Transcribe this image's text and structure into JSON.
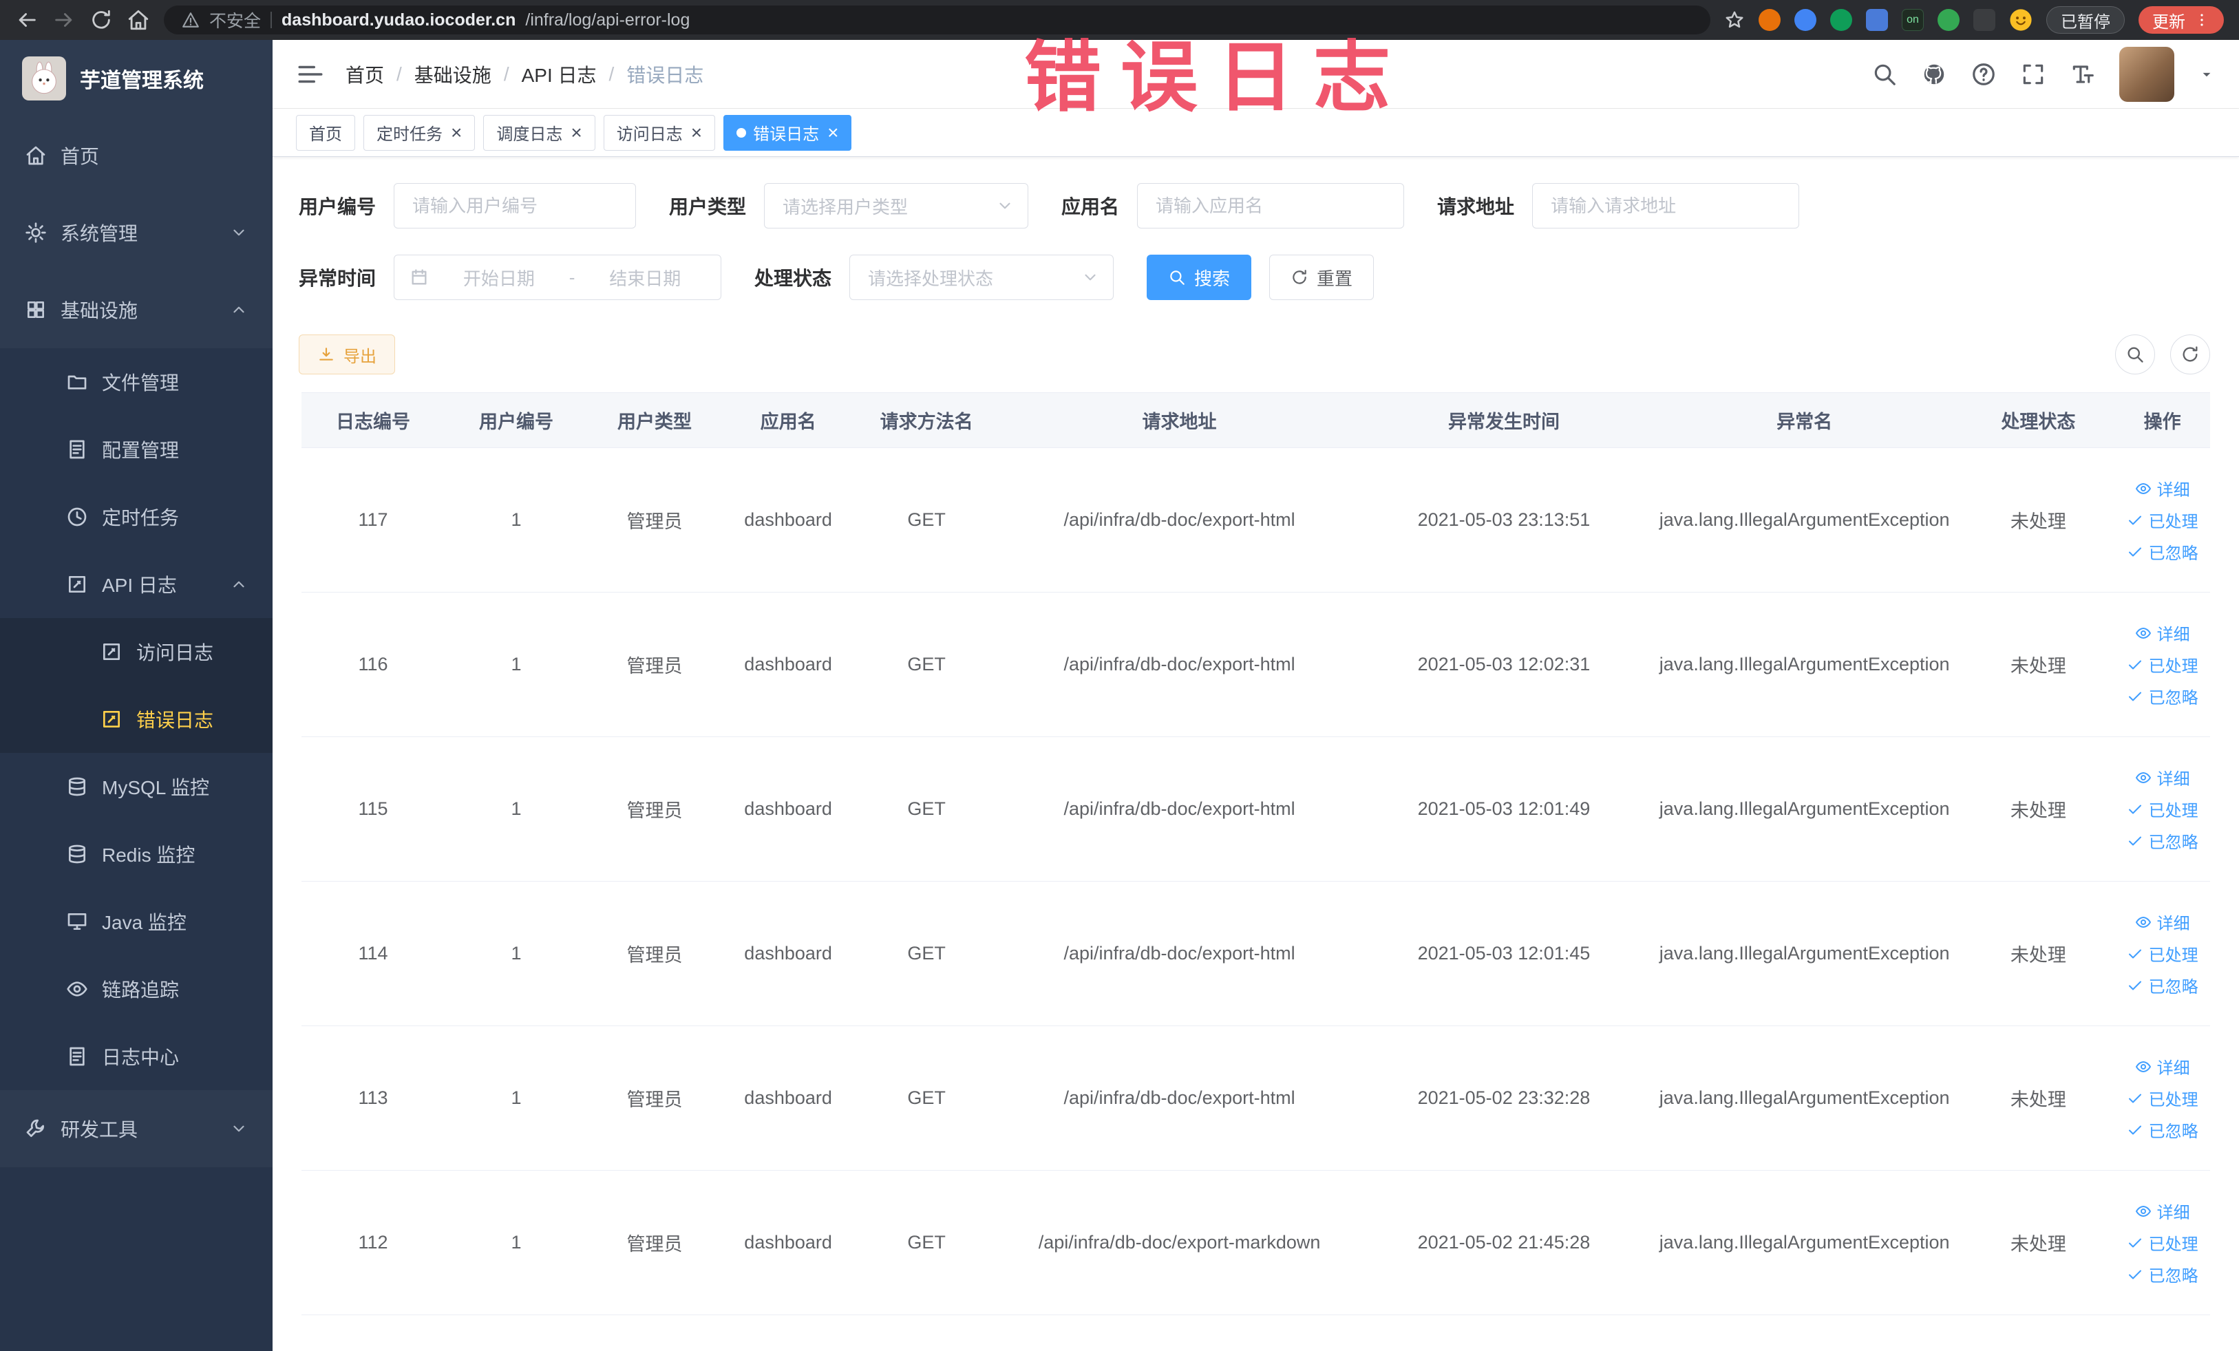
{
  "accent_colors": {
    "primary": "#409eff",
    "active_menu": "#ffd04b",
    "warning": "#e6a23c",
    "annotation": "#ef4b63"
  },
  "annotation": {
    "text": "错误日志"
  },
  "browser": {
    "security_label": "不安全",
    "url_host": "dashboard.yudao.iocoder.cn",
    "url_path": "/infra/log/api-error-log",
    "extension_on_label": "on",
    "paused_label": "已暂停",
    "update_label": "更新"
  },
  "sidebar": {
    "logo_title": "芋道管理系统",
    "items": [
      {
        "key": "home",
        "label": "首页",
        "icon": "home-icon",
        "level": 0
      },
      {
        "key": "system",
        "label": "系统管理",
        "icon": "gear-icon",
        "level": 0,
        "arrow": "down"
      },
      {
        "key": "infra",
        "label": "基础设施",
        "icon": "grid-icon",
        "level": 0,
        "arrow": "up"
      },
      {
        "key": "file-manage",
        "label": "文件管理",
        "icon": "folder-icon",
        "level": 1
      },
      {
        "key": "config-manage",
        "label": "配置管理",
        "icon": "doc-icon",
        "level": 1
      },
      {
        "key": "scheduled-job",
        "label": "定时任务",
        "icon": "clock-icon",
        "level": 1
      },
      {
        "key": "api-log",
        "label": "API 日志",
        "icon": "edit-icon",
        "level": 1,
        "arrow": "up"
      },
      {
        "key": "access-log",
        "label": "访问日志",
        "icon": "edit-icon",
        "level": 2
      },
      {
        "key": "error-log",
        "label": "错误日志",
        "icon": "edit-icon",
        "level": 2,
        "active": true
      },
      {
        "key": "mysql-monitor",
        "label": "MySQL 监控",
        "icon": "db-icon",
        "level": 1
      },
      {
        "key": "redis-monitor",
        "label": "Redis 监控",
        "icon": "db-icon",
        "level": 1
      },
      {
        "key": "java-monitor",
        "label": "Java 监控",
        "icon": "monitor-icon",
        "level": 1
      },
      {
        "key": "trace",
        "label": "链路追踪",
        "icon": "eye-icon",
        "level": 1
      },
      {
        "key": "log-center",
        "label": "日志中心",
        "icon": "doc-icon",
        "level": 1
      },
      {
        "key": "dev-tools",
        "label": "研发工具",
        "icon": "wrench-icon",
        "level": 0,
        "arrow": "down"
      }
    ]
  },
  "header": {
    "separator": "/",
    "breadcrumb": [
      {
        "label": "首页",
        "current": false
      },
      {
        "label": "基础设施",
        "current": false
      },
      {
        "label": "API 日志",
        "current": false
      },
      {
        "label": "错误日志",
        "current": true
      }
    ]
  },
  "tabs": [
    {
      "key": "home",
      "label": "首页",
      "closable": false,
      "active": false
    },
    {
      "key": "scheduled-job",
      "label": "定时任务",
      "closable": true,
      "active": false
    },
    {
      "key": "schedule-log",
      "label": "调度日志",
      "closable": true,
      "active": false
    },
    {
      "key": "access-log",
      "label": "访问日志",
      "closable": true,
      "active": false
    },
    {
      "key": "error-log",
      "label": "错误日志",
      "closable": true,
      "active": true
    }
  ],
  "filters": {
    "user_id": {
      "label": "用户编号",
      "placeholder": "请输入用户编号"
    },
    "user_type": {
      "label": "用户类型",
      "placeholder": "请选择用户类型"
    },
    "app_name": {
      "label": "应用名",
      "placeholder": "请输入应用名"
    },
    "request_url": {
      "label": "请求地址",
      "placeholder": "请输入请求地址"
    },
    "exception_time": {
      "label": "异常时间",
      "start_placeholder": "开始日期",
      "separator": "-",
      "end_placeholder": "结束日期"
    },
    "process_status": {
      "label": "处理状态",
      "placeholder": "请选择处理状态"
    },
    "search_label": "搜索",
    "reset_label": "重置"
  },
  "toolbar": {
    "export_label": "导出"
  },
  "table": {
    "columns": [
      "日志编号",
      "用户编号",
      "用户类型",
      "应用名",
      "请求方法名",
      "请求地址",
      "异常发生时间",
      "异常名",
      "处理状态",
      "操作"
    ],
    "row_actions": [
      {
        "key": "detail",
        "label": "详细",
        "icon": "eye-icon"
      },
      {
        "key": "processed",
        "label": "已处理",
        "icon": "check-icon"
      },
      {
        "key": "ignored",
        "label": "已忽略",
        "icon": "check-icon"
      }
    ],
    "rows": [
      {
        "log_id": "117",
        "user_id": "1",
        "user_type": "管理员",
        "app_name": "dashboard",
        "method": "GET",
        "url": "/api/infra/db-doc/export-html",
        "time": "2021-05-03 23:13:51",
        "exception": "java.lang.IllegalArgumentException",
        "status": "未处理"
      },
      {
        "log_id": "116",
        "user_id": "1",
        "user_type": "管理员",
        "app_name": "dashboard",
        "method": "GET",
        "url": "/api/infra/db-doc/export-html",
        "time": "2021-05-03 12:02:31",
        "exception": "java.lang.IllegalArgumentException",
        "status": "未处理"
      },
      {
        "log_id": "115",
        "user_id": "1",
        "user_type": "管理员",
        "app_name": "dashboard",
        "method": "GET",
        "url": "/api/infra/db-doc/export-html",
        "time": "2021-05-03 12:01:49",
        "exception": "java.lang.IllegalArgumentException",
        "status": "未处理"
      },
      {
        "log_id": "114",
        "user_id": "1",
        "user_type": "管理员",
        "app_name": "dashboard",
        "method": "GET",
        "url": "/api/infra/db-doc/export-html",
        "time": "2021-05-03 12:01:45",
        "exception": "java.lang.IllegalArgumentException",
        "status": "未处理"
      },
      {
        "log_id": "113",
        "user_id": "1",
        "user_type": "管理员",
        "app_name": "dashboard",
        "method": "GET",
        "url": "/api/infra/db-doc/export-html",
        "time": "2021-05-02 23:32:28",
        "exception": "java.lang.IllegalArgumentException",
        "status": "未处理"
      },
      {
        "log_id": "112",
        "user_id": "1",
        "user_type": "管理员",
        "app_name": "dashboard",
        "method": "GET",
        "url": "/api/infra/db-doc/export-markdown",
        "time": "2021-05-02 21:45:28",
        "exception": "java.lang.IllegalArgumentException",
        "status": "未处理"
      }
    ]
  }
}
